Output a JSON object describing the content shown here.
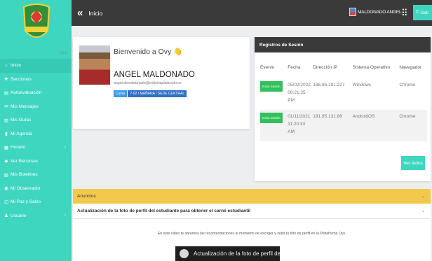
{
  "sidebar": {
    "small_label": "1.8.0",
    "items": [
      {
        "label": "Inicio",
        "icon": "home-icon",
        "glyph": "⌂",
        "active": true
      },
      {
        "label": "Secciones",
        "icon": "puzzle-icon",
        "glyph": "✚"
      },
      {
        "label": "Autoevaluación",
        "icon": "clipboard-icon",
        "glyph": "▤"
      },
      {
        "label": "Mis Mensajes",
        "icon": "envelope-icon",
        "glyph": "✉"
      },
      {
        "label": "Mis Guías",
        "icon": "document-icon",
        "glyph": "▥"
      },
      {
        "label": "Mi Agenda",
        "icon": "book-icon",
        "glyph": "▮"
      },
      {
        "label": "Horario",
        "icon": "calendar-icon",
        "glyph": "▦",
        "caret": true
      },
      {
        "label": "Ver Recursos",
        "icon": "recursos-icon",
        "glyph": "◆"
      },
      {
        "label": "Mis Boletines",
        "icon": "report-icon",
        "glyph": "▧"
      },
      {
        "label": "Mi Observador",
        "icon": "eye-icon",
        "glyph": "◉"
      },
      {
        "label": "Mi Paz y Salvo",
        "icon": "checklist-icon",
        "glyph": "☑"
      },
      {
        "label": "Usuario",
        "icon": "user-icon",
        "glyph": "♟",
        "caret": true
      }
    ]
  },
  "topbar": {
    "title": "Inicio",
    "back_glyph": "«",
    "user_name": "MALDONADO ANGEL",
    "logout_label": "Sali",
    "logout_glyph": "⏻"
  },
  "profile": {
    "welcome": "Bienvenido a Ovy",
    "welcome_emoji": "👋",
    "name": "ANGEL MALDONADO",
    "email": "angel.demaldonado@colteclaplata.edu.co",
    "badge_label": "Curso",
    "badge_value": "7-02 / MAÑANA / SEDE CENTRAL"
  },
  "sessions": {
    "title": "Registros de Sesión",
    "columns": [
      "Evento",
      "Fecha",
      "Dirección IP",
      "Sistema Operativo",
      "Navegador"
    ],
    "rows": [
      {
        "event": "Inicio Sesión",
        "date": "05/02/2022 08:21:35 PM",
        "ip": "186.85.191.227",
        "os": "Windows",
        "browser": "Chrome"
      },
      {
        "event": "Inicio Sesión",
        "date": "01/11/2021 11:20:33 AM",
        "ip": "191.95.131.68",
        "os": "AndroidOS",
        "browser": "Chrome"
      }
    ],
    "view_all": "Ver todos"
  },
  "announcements": {
    "header": "Anuncios",
    "item_title": "Actualización de la foto de perfil del estudiante para obtener el carné estudiantil",
    "item_text": "En este video te daremos las recomendaciones al momento de escoger y subir tu foto de perfil en la Plataforma Ovy.",
    "video_title": "Actualización de la foto de perfil del..."
  }
}
